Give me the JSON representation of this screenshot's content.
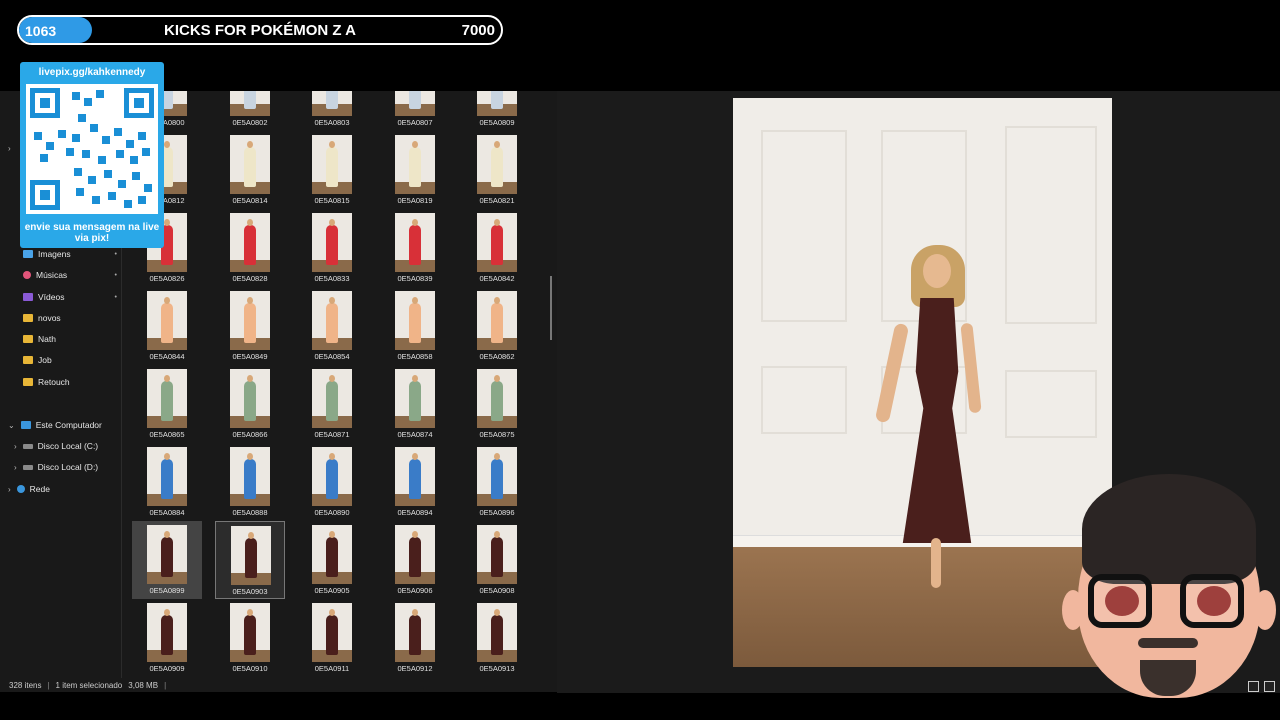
{
  "goal": {
    "current": "1063",
    "title": "KICKS FOR POKÉMON Z A",
    "target": "7000",
    "progress": 0.152,
    "fill_color": "#2f9ae6"
  },
  "qr": {
    "url": "livepix.gg/kahkennedy",
    "message": "envie sua mensagem na live via pix!",
    "color": "#2aa8e8"
  },
  "nav": {
    "quick_access": [
      {
        "label": "Imagens",
        "icon": "images-icon",
        "pinned": true
      },
      {
        "label": "Músicas",
        "icon": "music-icon",
        "pinned": true
      },
      {
        "label": "Vídeos",
        "icon": "videos-icon",
        "pinned": true
      },
      {
        "label": "novos",
        "icon": "folder-icon",
        "pinned": false
      },
      {
        "label": "Nath",
        "icon": "folder-icon",
        "pinned": false
      },
      {
        "label": "Job",
        "icon": "folder-icon",
        "pinned": false
      },
      {
        "label": "Retouch",
        "icon": "folder-icon",
        "pinned": false
      }
    ],
    "this_pc": "Este Computador",
    "drives": [
      "Disco Local (C:)",
      "Disco Local (D:)"
    ],
    "network": "Rede"
  },
  "thumbnails": [
    {
      "name": "0E5A0800",
      "color": "#c8d4e0"
    },
    {
      "name": "0E5A0802",
      "color": "#c8d4e0"
    },
    {
      "name": "0E5A0803",
      "color": "#c8d4e0"
    },
    {
      "name": "0E5A0807",
      "color": "#c8d4e0"
    },
    {
      "name": "0E5A0809",
      "color": "#c8d4e0"
    },
    {
      "name": "0E5A0812",
      "color": "#eee6c8"
    },
    {
      "name": "0E5A0814",
      "color": "#eee6c8"
    },
    {
      "name": "0E5A0815",
      "color": "#eee6c8"
    },
    {
      "name": "0E5A0819",
      "color": "#eee6c8"
    },
    {
      "name": "0E5A0821",
      "color": "#eee6c8"
    },
    {
      "name": "0E5A0826",
      "color": "#d83038"
    },
    {
      "name": "0E5A0828",
      "color": "#d83038"
    },
    {
      "name": "0E5A0833",
      "color": "#d83038"
    },
    {
      "name": "0E5A0839",
      "color": "#d83038"
    },
    {
      "name": "0E5A0842",
      "color": "#d83038"
    },
    {
      "name": "0E5A0844",
      "color": "#f0b488"
    },
    {
      "name": "0E5A0849",
      "color": "#f0b488"
    },
    {
      "name": "0E5A0854",
      "color": "#f0b488"
    },
    {
      "name": "0E5A0858",
      "color": "#f0b488"
    },
    {
      "name": "0E5A0862",
      "color": "#f0b488"
    },
    {
      "name": "0E5A0865",
      "color": "#8aa888"
    },
    {
      "name": "0E5A0866",
      "color": "#8aa888"
    },
    {
      "name": "0E5A0871",
      "color": "#8aa888"
    },
    {
      "name": "0E5A0874",
      "color": "#8aa888"
    },
    {
      "name": "0E5A0875",
      "color": "#8aa888"
    },
    {
      "name": "0E5A0884",
      "color": "#3a7cc8"
    },
    {
      "name": "0E5A0888",
      "color": "#3a7cc8"
    },
    {
      "name": "0E5A0890",
      "color": "#3a7cc8"
    },
    {
      "name": "0E5A0894",
      "color": "#3a7cc8"
    },
    {
      "name": "0E5A0896",
      "color": "#3a7cc8"
    },
    {
      "name": "0E5A0899",
      "color": "#4a1f1c",
      "state": "hover"
    },
    {
      "name": "0E5A0903",
      "color": "#4a1f1c",
      "state": "selected"
    },
    {
      "name": "0E5A0905",
      "color": "#4a1f1c"
    },
    {
      "name": "0E5A0906",
      "color": "#4a1f1c"
    },
    {
      "name": "0E5A0908",
      "color": "#4a1f1c"
    },
    {
      "name": "0E5A0909",
      "color": "#4a1f1c"
    },
    {
      "name": "0E5A0910",
      "color": "#4a1f1c"
    },
    {
      "name": "0E5A0911",
      "color": "#4a1f1c"
    },
    {
      "name": "0E5A0912",
      "color": "#4a1f1c"
    },
    {
      "name": "0E5A0913",
      "color": "#4a1f1c"
    }
  ],
  "status": {
    "count": "328 itens",
    "selection": "1 item selecionado",
    "size": "3,08 MB"
  }
}
